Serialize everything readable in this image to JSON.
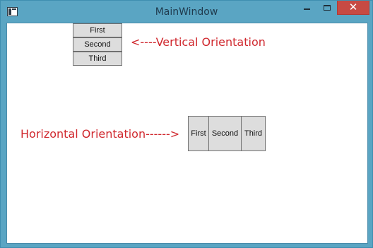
{
  "window": {
    "title": "MainWindow",
    "close_glyph": "✕",
    "accent_color": "#5aa5c3",
    "close_color": "#c74a43"
  },
  "icons": {
    "app": "app-window-icon",
    "minimize": "minimize-icon",
    "maximize": "maximize-icon",
    "close": "close-icon"
  },
  "vertical_panel": {
    "buttons": [
      "First",
      "Second",
      "Third"
    ],
    "label": "<----Vertical Orientation"
  },
  "horizontal_panel": {
    "buttons": [
      "First",
      "Second",
      "Third"
    ],
    "label": "Horizontal Orientation------>"
  },
  "label_color": "#d0282e"
}
